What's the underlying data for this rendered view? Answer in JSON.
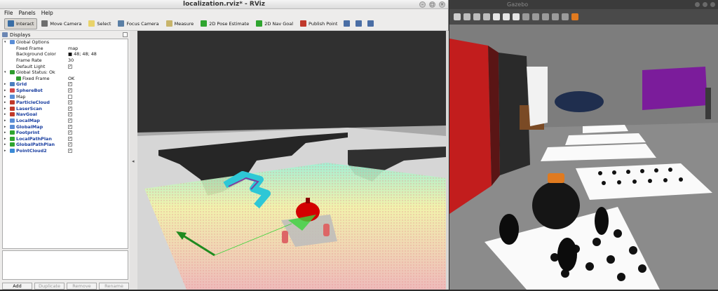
{
  "rviz": {
    "title": "localization.rviz* - RViz",
    "menu": [
      "File",
      "Panels",
      "Help"
    ],
    "tools": [
      {
        "label": "Interact",
        "icon": "interact-icon",
        "color": "#3a6ea5",
        "active": true
      },
      {
        "label": "Move Camera",
        "icon": "move-camera-icon",
        "color": "#6e6e6e",
        "active": false
      },
      {
        "label": "Select",
        "icon": "select-icon",
        "color": "#e9d36a",
        "active": false
      },
      {
        "label": "Focus Camera",
        "icon": "focus-camera-icon",
        "color": "#5a7fa5",
        "active": false
      },
      {
        "label": "Measure",
        "icon": "measure-icon",
        "color": "#c8b46a",
        "active": false
      },
      {
        "label": "2D Pose Estimate",
        "icon": "pose-estimate-icon",
        "color": "#2fa52f",
        "active": false
      },
      {
        "label": "2D Nav Goal",
        "icon": "nav-goal-icon",
        "color": "#2fa52f",
        "active": false
      },
      {
        "label": "Publish Point",
        "icon": "publish-point-icon",
        "color": "#c0392b",
        "active": false
      }
    ],
    "panel_title": "Displays",
    "displays": [
      {
        "indent": 0,
        "arrow": "▾",
        "icon": "#5a8dd6",
        "label": "Global Options",
        "plugin": false,
        "value": ""
      },
      {
        "indent": 1,
        "arrow": "",
        "icon": "",
        "label": "Fixed Frame",
        "plugin": false,
        "value": "map"
      },
      {
        "indent": 1,
        "arrow": "",
        "icon": "",
        "label": "Background Color",
        "plugin": false,
        "value": "■ 48; 48; 48"
      },
      {
        "indent": 1,
        "arrow": "",
        "icon": "",
        "label": "Frame Rate",
        "plugin": false,
        "value": "30"
      },
      {
        "indent": 1,
        "arrow": "",
        "icon": "",
        "label": "Default Light",
        "plugin": false,
        "check": true
      },
      {
        "indent": 0,
        "arrow": "▾",
        "icon": "#2d9c2d",
        "label": "Global Status: Ok",
        "plugin": false,
        "value": ""
      },
      {
        "indent": 1,
        "arrow": "",
        "icon": "#2d9c2d",
        "label": "Fixed Frame",
        "plugin": false,
        "value": "OK"
      },
      {
        "indent": 0,
        "arrow": "▸",
        "icon": "#4a7fbf",
        "label": "Grid",
        "plugin": true,
        "check": true
      },
      {
        "indent": 0,
        "arrow": "▸",
        "icon": "#d24646",
        "label": "SphereBot",
        "plugin": true,
        "check": true
      },
      {
        "indent": 0,
        "arrow": "▸",
        "icon": "#5a8dd6",
        "label": "Map",
        "plugin": false,
        "check": false
      },
      {
        "indent": 0,
        "arrow": "▸",
        "icon": "#c0392b",
        "label": "ParticleCloud",
        "plugin": true,
        "check": true
      },
      {
        "indent": 0,
        "arrow": "▸",
        "icon": "#c0392b",
        "label": "LaserScan",
        "plugin": true,
        "check": true
      },
      {
        "indent": 0,
        "arrow": "▸",
        "icon": "#c0392b",
        "label": "NavGoal",
        "plugin": true,
        "check": true
      },
      {
        "indent": 0,
        "arrow": "▸",
        "icon": "#5a8dd6",
        "label": "LocalMap",
        "plugin": true,
        "check": true
      },
      {
        "indent": 0,
        "arrow": "▸",
        "icon": "#5a8dd6",
        "label": "GlobalMap",
        "plugin": true,
        "check": true
      },
      {
        "indent": 0,
        "arrow": "▸",
        "icon": "#2fa52f",
        "label": "Footprint",
        "plugin": true,
        "check": true
      },
      {
        "indent": 0,
        "arrow": "▸",
        "icon": "#2fa52f",
        "label": "LocalPathPlan",
        "plugin": true,
        "check": true
      },
      {
        "indent": 0,
        "arrow": "▸",
        "icon": "#2fa52f",
        "label": "GlobalPathPlan",
        "plugin": true,
        "check": true
      },
      {
        "indent": 0,
        "arrow": "▸",
        "icon": "#3a8ad6",
        "label": "PointCloud2",
        "plugin": true,
        "check": true
      }
    ],
    "buttons": [
      {
        "label": "Add",
        "enabled": true
      },
      {
        "label": "Duplicate",
        "enabled": false
      },
      {
        "label": "Remove",
        "enabled": false
      },
      {
        "label": "Rename",
        "enabled": false
      }
    ]
  },
  "gazebo": {
    "title": "Gazebo",
    "toolbar_icons": [
      "pointer-icon",
      "box-icon",
      "sphere-icon",
      "cylinder-icon",
      "sun-icon",
      "spot-light-icon",
      "dir-light-icon",
      "copy-icon",
      "paste-icon",
      "align-icon",
      "snap-icon",
      "magnet-icon",
      "screenshot-icon"
    ]
  }
}
